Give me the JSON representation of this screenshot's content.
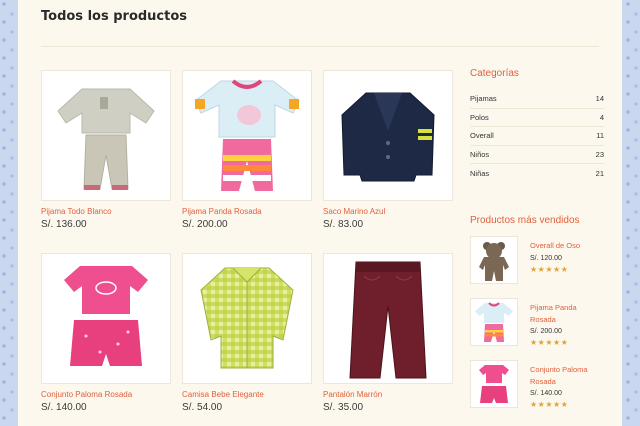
{
  "page": {
    "title": "Todos los productos"
  },
  "products": [
    {
      "name": "Pijama Todo Blanco",
      "price": "S/. 136.00",
      "icon": "pajama-white-image"
    },
    {
      "name": "Pijama Panda Rosada",
      "price": "S/. 200.00",
      "icon": "pajama-panda-pink-image"
    },
    {
      "name": "Saco Marino Azul",
      "price": "S/. 83.00",
      "icon": "navy-cardigan-image"
    },
    {
      "name": "Conjunto Paloma Rosada",
      "price": "S/. 140.00",
      "icon": "pink-set-image"
    },
    {
      "name": "Camisa Bebe Elegante",
      "price": "S/. 54.00",
      "icon": "gingham-shirt-image"
    },
    {
      "name": "Pantalón Marrón",
      "price": "S/. 35.00",
      "icon": "brown-pants-image"
    }
  ],
  "sidebar": {
    "categories_heading": "Categorías",
    "categories": [
      {
        "label": "Pijamas",
        "count": "14"
      },
      {
        "label": "Polos",
        "count": "4"
      },
      {
        "label": "Overall",
        "count": "11"
      },
      {
        "label": "Niños",
        "count": "23"
      },
      {
        "label": "Niñas",
        "count": "21"
      }
    ],
    "bestsellers_heading": "Productos más vendidos",
    "bestsellers": [
      {
        "name": "Overall de Oso",
        "price": "S/. 120.00",
        "stars": "★★★★★",
        "rating": 5
      },
      {
        "name": "Pijama Panda Rosada",
        "price": "S/. 200.00",
        "stars": "★★★★★",
        "rating": 5
      },
      {
        "name": "Conjunto Paloma Rosada",
        "price": "S/. 140.00",
        "stars": "★★★★★",
        "rating": 5
      }
    ]
  },
  "colors": {
    "accent": "#e0613d",
    "page_background": "#fdf8ee",
    "star": "#e0a23a"
  }
}
